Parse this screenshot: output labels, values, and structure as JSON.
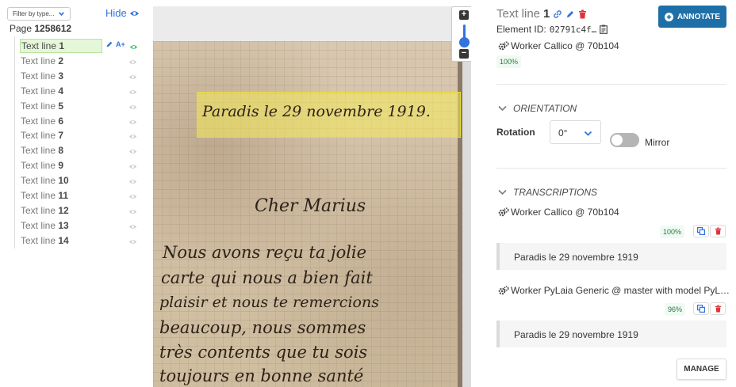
{
  "left": {
    "filter_placeholder": "Filter by type...",
    "hide_label": "Hide",
    "page_prefix": "Page",
    "page_number": "1258612",
    "lines": [
      {
        "prefix": "Text line",
        "num": "1"
      },
      {
        "prefix": "Text line",
        "num": "2"
      },
      {
        "prefix": "Text line",
        "num": "3"
      },
      {
        "prefix": "Text line",
        "num": "4"
      },
      {
        "prefix": "Text line",
        "num": "5"
      },
      {
        "prefix": "Text line",
        "num": "6"
      },
      {
        "prefix": "Text line",
        "num": "7"
      },
      {
        "prefix": "Text line",
        "num": "8"
      },
      {
        "prefix": "Text line",
        "num": "9"
      },
      {
        "prefix": "Text line",
        "num": "10"
      },
      {
        "prefix": "Text line",
        "num": "11"
      },
      {
        "prefix": "Text line",
        "num": "12"
      },
      {
        "prefix": "Text line",
        "num": "13"
      },
      {
        "prefix": "Text line",
        "num": "14"
      }
    ],
    "aplus": "A+"
  },
  "viewer": {
    "handwriting": [
      "Paradis le 29 novembre 1919.",
      "Cher Marius",
      "Nous avons reçu ta jolie",
      "carte qui nous a bien fait",
      "plaisir et nous te remercions",
      "beaucoup, nous sommes",
      "très contents que tu sois",
      "toujours en bonne santé"
    ],
    "zoom_in": "+",
    "zoom_out": "−"
  },
  "right": {
    "title_prefix": "Text line",
    "title_num": "1",
    "annotate_label": "ANNOTATE",
    "element_id_label": "Element ID:",
    "element_id_value": "02791c4f…",
    "worker_main": "Worker Callico @ 70b104",
    "worker_main_conf": "100%",
    "orientation_label": "ORIENTATION",
    "rotation_label": "Rotation",
    "rotation_value": "0°",
    "mirror_label": "Mirror",
    "transcriptions_label": "TRANSCRIPTIONS",
    "transcriptions": [
      {
        "worker": "Worker Callico @ 70b104",
        "confidence": "100%",
        "text": "Paradis le 29 novembre 1919"
      },
      {
        "worker": "Worker PyLaia Generic @ master with model PyL…",
        "confidence": "96%",
        "text": "Paradis le 29 novembre 1919"
      }
    ],
    "manage_label": "MANAGE"
  },
  "colors": {
    "link": "#3273dc",
    "primary_button": "#1e6fa8",
    "selection_bg": "#e6f7d9",
    "success_text": "#257942",
    "danger": "#e0333b",
    "highlight": "#f5eb5a"
  }
}
